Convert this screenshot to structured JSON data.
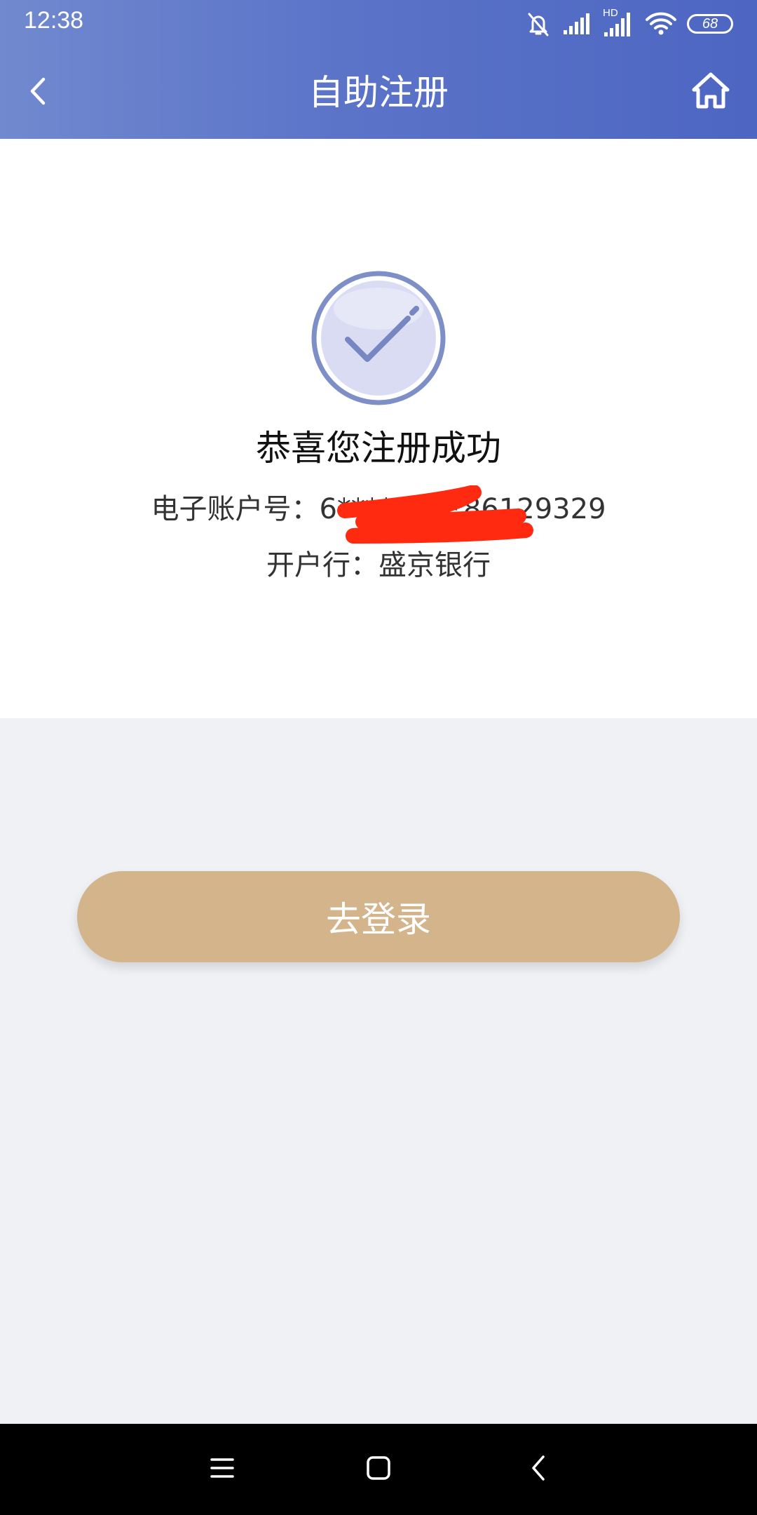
{
  "status_bar": {
    "time": "12:38",
    "battery": "68",
    "network_label": "HD"
  },
  "nav": {
    "title": "自助注册"
  },
  "success": {
    "title": "恭喜您注册成功",
    "account_label": "电子账户号：",
    "account_number": "6*********86129329",
    "bank_label": "开户行：",
    "bank_name": "盛京银行"
  },
  "actions": {
    "login_label": "去登录"
  },
  "colors": {
    "header_gradient_start": "#7189cf",
    "header_gradient_end": "#4d66c2",
    "button": "#d4b48b",
    "page_background": "#eff1f5",
    "check_circle": "#7d8fc6",
    "redaction": "#ff2a10"
  },
  "icons": {
    "back": "chevron-left-icon",
    "home": "home-icon",
    "success": "check-circle-icon",
    "system_menu": "menu-icon",
    "system_home": "square-icon",
    "system_back": "chevron-left-icon"
  }
}
